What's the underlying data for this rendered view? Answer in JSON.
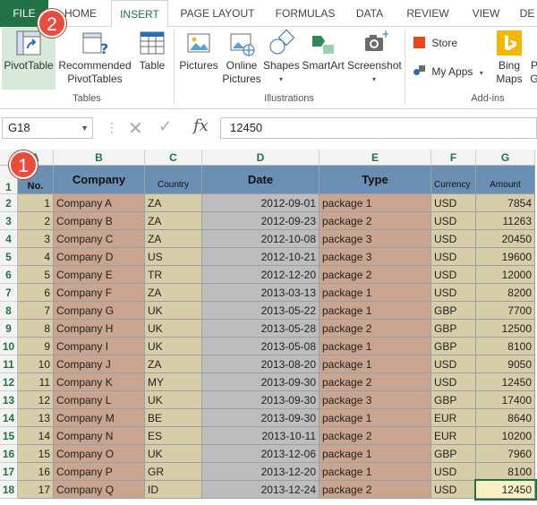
{
  "tabs": [
    "FILE",
    "HOME",
    "INSERT",
    "PAGE LAYOUT",
    "FORMULAS",
    "DATA",
    "REVIEW",
    "VIEW",
    "DE"
  ],
  "ribbon": {
    "pivottable": "PivotTable",
    "recommended1": "Recommended",
    "recommended2": "PivotTables",
    "table": "Table",
    "pictures": "Pictures",
    "online1": "Online",
    "online2": "Pictures",
    "shapes": "Shapes",
    "smartart": "SmartArt",
    "screenshot": "Screenshot",
    "store": "Store",
    "myapps": "My Apps",
    "bing1": "Bing",
    "bing2": "Maps",
    "next1": "P",
    "next2": "G",
    "group_tables": "Tables",
    "group_illustrations": "Illustrations",
    "group_addins": "Add-ins"
  },
  "badges": {
    "one": "1",
    "two": "2"
  },
  "formula_bar": {
    "cell_ref": "G18",
    "value": "12450"
  },
  "columns": [
    "A",
    "B",
    "C",
    "D",
    "E",
    "F",
    "G"
  ],
  "headers": [
    "No.",
    "Company",
    "Country",
    "Date",
    "Type",
    "Currency",
    "Amount"
  ],
  "rows": [
    [
      "1",
      "Company A",
      "ZA",
      "2012-09-01",
      "package 1",
      "USD",
      "7854"
    ],
    [
      "2",
      "Company B",
      "ZA",
      "2012-09-23",
      "package 2",
      "USD",
      "11263"
    ],
    [
      "3",
      "Company C",
      "ZA",
      "2012-10-08",
      "package 3",
      "USD",
      "20450"
    ],
    [
      "4",
      "Company D",
      "US",
      "2012-10-21",
      "package 3",
      "USD",
      "19600"
    ],
    [
      "5",
      "Company E",
      "TR",
      "2012-12-20",
      "package 2",
      "USD",
      "12000"
    ],
    [
      "6",
      "Company F",
      "ZA",
      "2013-03-13",
      "package 1",
      "USD",
      "8200"
    ],
    [
      "7",
      "Company G",
      "UK",
      "2013-05-22",
      "package 1",
      "GBP",
      "7700"
    ],
    [
      "8",
      "Company H",
      "UK",
      "2013-05-28",
      "package 2",
      "GBP",
      "12500"
    ],
    [
      "9",
      "Company I",
      "UK",
      "2013-05-08",
      "package 1",
      "GBP",
      "8100"
    ],
    [
      "10",
      "Company J",
      "ZA",
      "2013-08-20",
      "package 1",
      "USD",
      "9050"
    ],
    [
      "11",
      "Company K",
      "MY",
      "2013-09-30",
      "package 2",
      "USD",
      "12450"
    ],
    [
      "12",
      "Company L",
      "UK",
      "2013-09-30",
      "package 3",
      "GBP",
      "17400"
    ],
    [
      "13",
      "Company M",
      "BE",
      "2013-09-30",
      "package 1",
      "EUR",
      "8640"
    ],
    [
      "14",
      "Company N",
      "ES",
      "2013-10-11",
      "package 2",
      "EUR",
      "10200"
    ],
    [
      "15",
      "Company O",
      "UK",
      "2013-12-06",
      "package 1",
      "GBP",
      "7960"
    ],
    [
      "16",
      "Company P",
      "GR",
      "2013-12-20",
      "package 1",
      "USD",
      "8100"
    ],
    [
      "17",
      "Company Q",
      "ID",
      "2013-12-24",
      "package 2",
      "USD",
      "12450"
    ]
  ],
  "colors": {
    "excel_green": "#217346",
    "header_fill": "#6b8fb3",
    "col_a": "#d7cda8",
    "col_b": "#c9a48f",
    "col_c": "#d7cda8",
    "col_d": "#bdbdbd",
    "col_e": "#c9a48f",
    "col_f": "#d7cda8",
    "col_g": "#d7cda8",
    "active_cell": "#fcefc6"
  }
}
